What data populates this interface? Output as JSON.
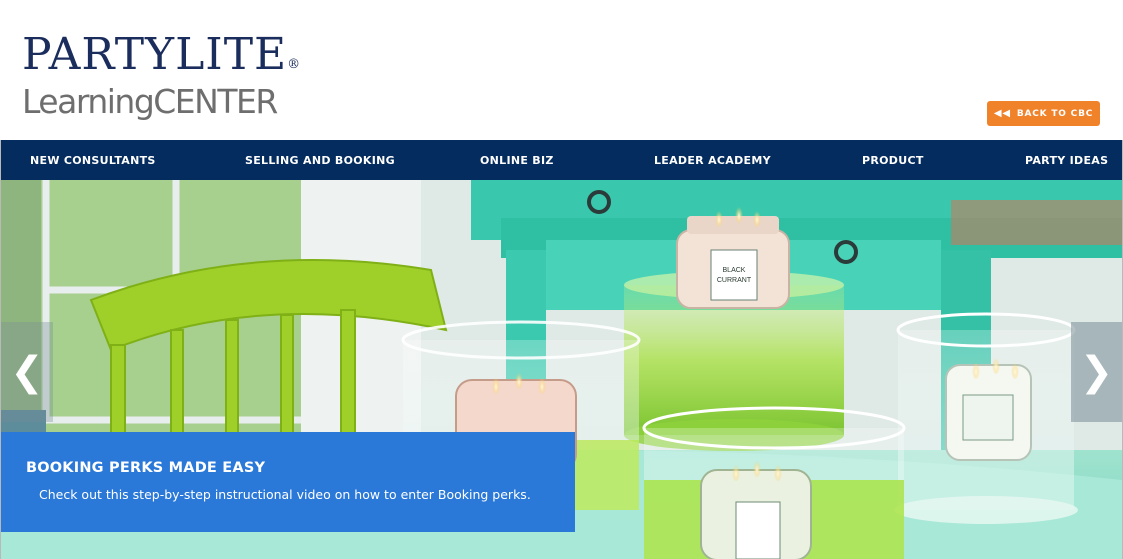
{
  "header": {
    "logo_brand": "PARTYLITE",
    "logo_reg": "®",
    "logo_sub": "LearningCENTER",
    "back_button": {
      "label": "BACK TO CBC",
      "icon": "double-chevron-left-icon",
      "color": "#f0822a"
    }
  },
  "nav": {
    "background": "#042c5e",
    "items": [
      {
        "label": "NEW CONSULTANTS"
      },
      {
        "label": "SELLING AND BOOKING"
      },
      {
        "label": "ONLINE BIZ"
      },
      {
        "label": "LEADER ACADEMY"
      },
      {
        "label": "PRODUCT"
      },
      {
        "label": "PARTY IDEAS"
      }
    ]
  },
  "hero": {
    "prev_icon": "chevron-left-icon",
    "next_icon": "chevron-right-icon",
    "caption": {
      "title": "BOOKING PERKS MADE EASY",
      "text": "Check out this step-by-step instructional video on how to enter Booking perks.",
      "color": "#2a78d8"
    },
    "jar_labels": {
      "top": "BLACK CURRANT"
    }
  }
}
